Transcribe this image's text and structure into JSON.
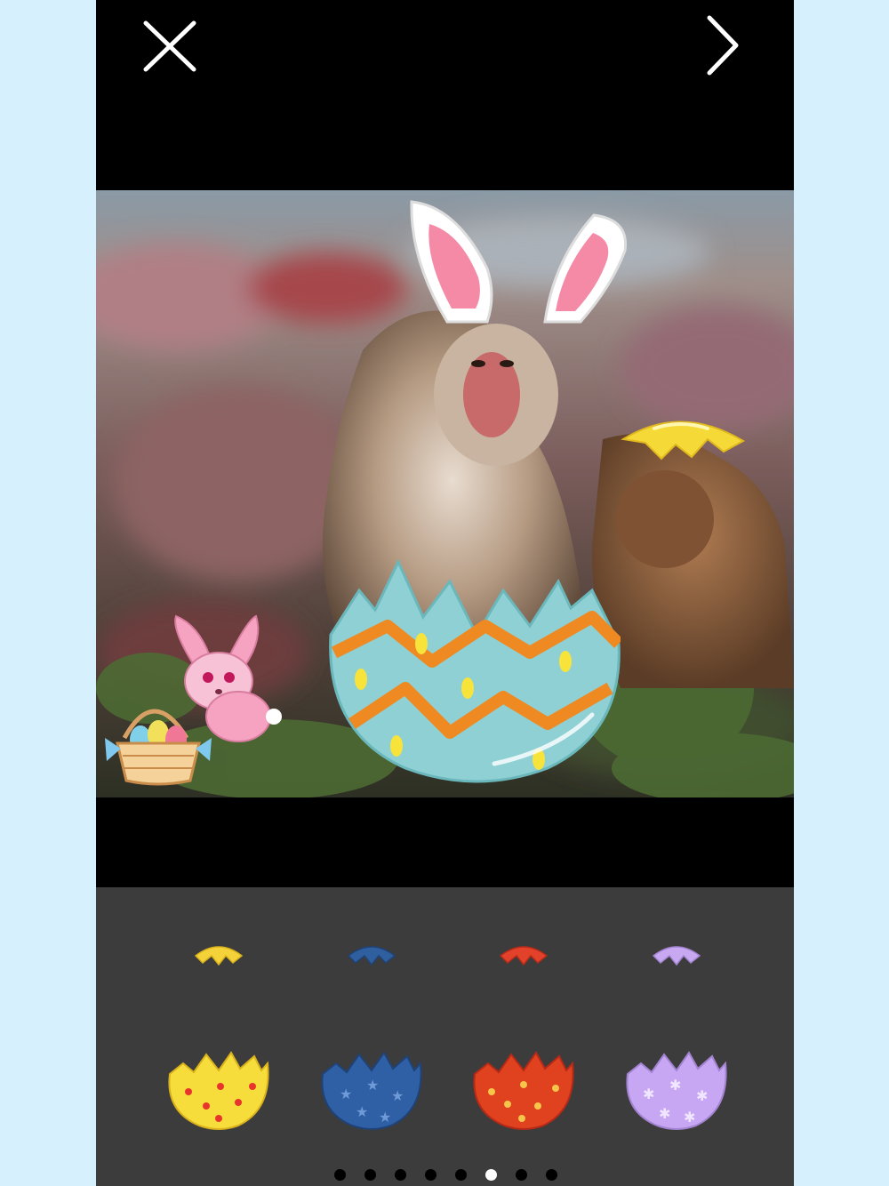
{
  "toolbar": {
    "close_icon": "close-icon",
    "next_icon": "chevron-right-icon"
  },
  "canvas": {
    "photo": "two monkeys in greenery",
    "stickers": [
      "bunny-ears-sticker",
      "egg-cap-sticker",
      "cracked-egg-sticker",
      "bunny-sticker",
      "egg-basket-sticker"
    ]
  },
  "panel": {
    "caps": [
      {
        "color": "#f4d23a"
      },
      {
        "color": "#2f5f9e"
      },
      {
        "color": "#e2412a"
      },
      {
        "color": "#c9a8f2"
      }
    ],
    "shells": [
      {
        "color": "#f6dd3c",
        "pattern": "flowers"
      },
      {
        "color": "#2f5fa4",
        "pattern": "stars"
      },
      {
        "color": "#e0411f",
        "pattern": "dots"
      },
      {
        "color": "#c7a6f4",
        "pattern": "stars"
      }
    ],
    "page_count": 8,
    "active_page": 6
  },
  "colors": {
    "background": "#d6f0fd",
    "panel": "#3c3c3c"
  }
}
